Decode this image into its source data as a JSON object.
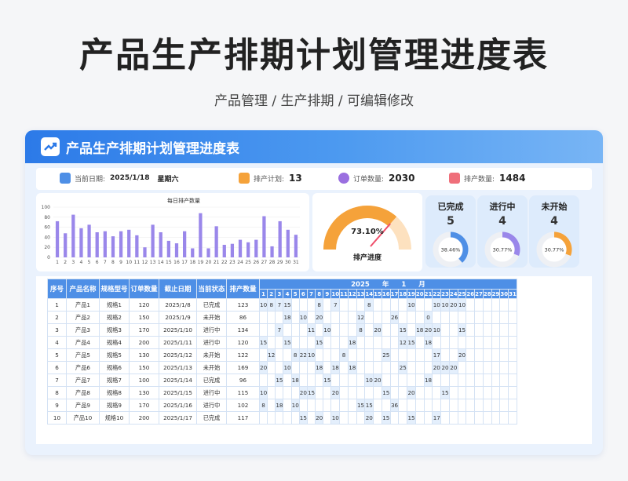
{
  "page": {
    "title": "产品生产排期计划管理进度表",
    "subtitle": "产品管理 / 生产排期 / 可编辑修改"
  },
  "card": {
    "title": "产品生产排期计划管理进度表"
  },
  "info_bar": {
    "date_label": "当前日期:",
    "date_value": "2025/1/18",
    "weekday": "星期六",
    "plan_label": "排产计划:",
    "plan_value": "13",
    "orders_label": "订单数量:",
    "orders_value": "2030",
    "production_label": "排产数量:",
    "production_value": "1484"
  },
  "chart_data": {
    "type": "bar",
    "title": "每日排产数量",
    "categories": [
      "1",
      "2",
      "3",
      "4",
      "5",
      "6",
      "7",
      "8",
      "9",
      "10",
      "11",
      "12",
      "13",
      "14",
      "15",
      "16",
      "17",
      "18",
      "19",
      "20",
      "21",
      "22",
      "23",
      "24",
      "25",
      "26",
      "27",
      "28",
      "29",
      "30",
      "31"
    ],
    "values": [
      72,
      48,
      85,
      58,
      65,
      50,
      52,
      42,
      52,
      55,
      44,
      20,
      65,
      50,
      33,
      28,
      52,
      18,
      88,
      18,
      62,
      25,
      27,
      35,
      30,
      35,
      82,
      22,
      72,
      55,
      45
    ],
    "ylim": [
      0,
      100
    ],
    "yticks": [
      "0",
      "20",
      "40",
      "60",
      "80",
      "100"
    ],
    "color": "#9a87ea"
  },
  "gauge": {
    "value": 0.731,
    "label": "73.10%",
    "caption": "排产进度"
  },
  "stats": [
    {
      "label": "已完成",
      "count": "5",
      "percent": "38.46%",
      "fraction": 0.3846,
      "color": "#4e8fe6"
    },
    {
      "label": "进行中",
      "count": "4",
      "percent": "30.77%",
      "fraction": 0.3077,
      "color": "#9a87ea"
    },
    {
      "label": "未开始",
      "count": "4",
      "percent": "30.77%",
      "fraction": 0.3077,
      "color": "#f5a23a"
    }
  ],
  "table": {
    "headers": [
      "序号",
      "产品名称",
      "规格型号",
      "订单数量",
      "截止日期",
      "当前状态",
      "排产数量"
    ],
    "year": "2025",
    "year_unit": "年",
    "month": "1",
    "month_unit": "月",
    "rows": [
      {
        "no": "1",
        "name": "产品1",
        "spec": "规格1",
        "qty": "120",
        "due": "2025/1/8",
        "status": "已完成",
        "sched": "123",
        "days": {
          "1": "10",
          "2": "8",
          "3": "7",
          "4": "15",
          "8": "8",
          "10": "7",
          "14": "8",
          "19": "10",
          "22": "10",
          "23": "10",
          "24": "20",
          "25": "10"
        }
      },
      {
        "no": "2",
        "name": "产品2",
        "spec": "规格2",
        "qty": "150",
        "due": "2025/1/9",
        "status": "未开始",
        "sched": "86",
        "days": {
          "4": "18",
          "6": "10",
          "8": "20",
          "13": "12",
          "17": "26",
          "21": "0"
        }
      },
      {
        "no": "3",
        "name": "产品3",
        "spec": "规格3",
        "qty": "170",
        "due": "2025/1/10",
        "status": "进行中",
        "sched": "134",
        "days": {
          "3": "7",
          "7": "11",
          "9": "10",
          "13": "8",
          "15": "20",
          "18": "15",
          "20": "18",
          "21": "20",
          "22": "10",
          "25": "15"
        }
      },
      {
        "no": "4",
        "name": "产品4",
        "spec": "规格4",
        "qty": "200",
        "due": "2025/1/11",
        "status": "进行中",
        "sched": "120",
        "days": {
          "1": "15",
          "4": "15",
          "8": "15",
          "12": "18",
          "18": "12",
          "19": "15",
          "21": "18"
        }
      },
      {
        "no": "5",
        "name": "产品5",
        "spec": "规格5",
        "qty": "130",
        "due": "2025/1/12",
        "status": "未开始",
        "sched": "122",
        "days": {
          "2": "12",
          "5": "8",
          "6": "22",
          "7": "10",
          "11": "8",
          "16": "25",
          "22": "17",
          "25": "20"
        }
      },
      {
        "no": "6",
        "name": "产品6",
        "spec": "规格6",
        "qty": "150",
        "due": "2025/1/13",
        "status": "未开始",
        "sched": "169",
        "days": {
          "1": "20",
          "4": "10",
          "8": "18",
          "10": "18",
          "12": "18",
          "18": "25",
          "22": "20",
          "23": "20",
          "24": "20"
        }
      },
      {
        "no": "7",
        "name": "产品7",
        "spec": "规格7",
        "qty": "100",
        "due": "2025/1/14",
        "status": "已完成",
        "sched": "96",
        "days": {
          "3": "15",
          "5": "18",
          "9": "15",
          "14": "10",
          "15": "20",
          "21": "18"
        }
      },
      {
        "no": "8",
        "name": "产品8",
        "spec": "规格8",
        "qty": "130",
        "due": "2025/1/15",
        "status": "进行中",
        "sched": "115",
        "days": {
          "1": "10",
          "6": "20",
          "7": "15",
          "10": "20",
          "16": "15",
          "19": "20",
          "23": "15"
        }
      },
      {
        "no": "9",
        "name": "产品9",
        "spec": "规格9",
        "qty": "170",
        "due": "2025/1/16",
        "status": "进行中",
        "sched": "102",
        "days": {
          "1": "8",
          "3": "18",
          "5": "10",
          "13": "15",
          "14": "15",
          "17": "36"
        }
      },
      {
        "no": "10",
        "name": "产品10",
        "spec": "规格10",
        "qty": "200",
        "due": "2025/1/17",
        "status": "已完成",
        "sched": "117",
        "days": {
          "6": "15",
          "8": "20",
          "10": "10",
          "14": "20",
          "16": "15",
          "19": "15",
          "22": "17"
        }
      }
    ]
  }
}
